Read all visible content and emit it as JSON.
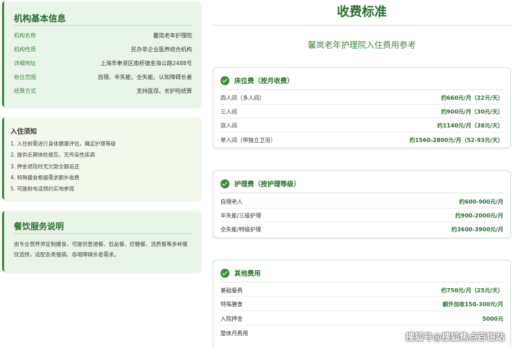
{
  "info": {
    "title": "机构基本信息",
    "rows": [
      {
        "key": "机构名称",
        "value": "馨岚老年护理院"
      },
      {
        "key": "机构性质",
        "value": "民办非企业医养结合机构"
      },
      {
        "key": "详细地址",
        "value": "上海市奉贤区南桥镇金海公路2488号"
      },
      {
        "key": "收住范围",
        "value": "自理、半失能、全失能、认知障碍长者"
      },
      {
        "key": "结算方式",
        "value": "支持医保、长护险结算"
      }
    ]
  },
  "notice": {
    "title": "入住须知",
    "items": [
      "1. 入住前需进行身体健康评估，确定护理等级",
      "2. 提供近期体检报告，无传染性疾病",
      "3. 押金退院时无欠款全额返还",
      "4. 特殊膳食根据需求额外收费",
      "5. 可提前电话预约实地参观"
    ]
  },
  "dining": {
    "title": "餐饮服务说明",
    "text": "由专业营养师定制膳食，可提供普通餐、低盐餐、控糖餐、流质餐等多种餐饮选择，适配各类慢病、吞咽障碍长者需求。"
  },
  "main": {
    "title": "收费标准",
    "subtitle": "馨岚老年护理院入住费用参考"
  },
  "bed_fee": {
    "title": "床位费（按月收费）",
    "rows": [
      {
        "name": "四人间（多人间）",
        "price": "约660元/月（22元/天）"
      },
      {
        "name": "三人间",
        "price": "约900元/月（30元/天）"
      },
      {
        "name": "双人间",
        "price": "约1140元/月（38元/天）"
      },
      {
        "name": "单人间（带独立卫浴）",
        "price": "约1560-2800元/月（52-93元/天）"
      }
    ]
  },
  "care_fee": {
    "title": "护理费（按护理等级）",
    "rows": [
      {
        "name": "自理老人",
        "price": "约600-900元/月"
      },
      {
        "name": "半失能/三级护理",
        "price": "约900-2000元/月"
      },
      {
        "name": "全失能/特级护理",
        "price": "约3600-3900元/月"
      }
    ]
  },
  "other_fee": {
    "title": "其他费用",
    "rows": [
      {
        "name": "基础餐费",
        "price": "约750元/月（25元/天）"
      },
      {
        "name": "特殊膳食",
        "price": "额外加收150-300元/月"
      },
      {
        "name": "入院押金",
        "price": "5000元"
      },
      {
        "name": "整体月费用",
        "price": ""
      }
    ]
  },
  "watermark": "搜狐号@搜狐焦点百银站",
  "icons": {
    "section_check": "check-circle-icon"
  },
  "colors": {
    "accent": "#2c6e2f",
    "accent_light": "#3d8b40",
    "card_bg": "#e9f5e9"
  }
}
